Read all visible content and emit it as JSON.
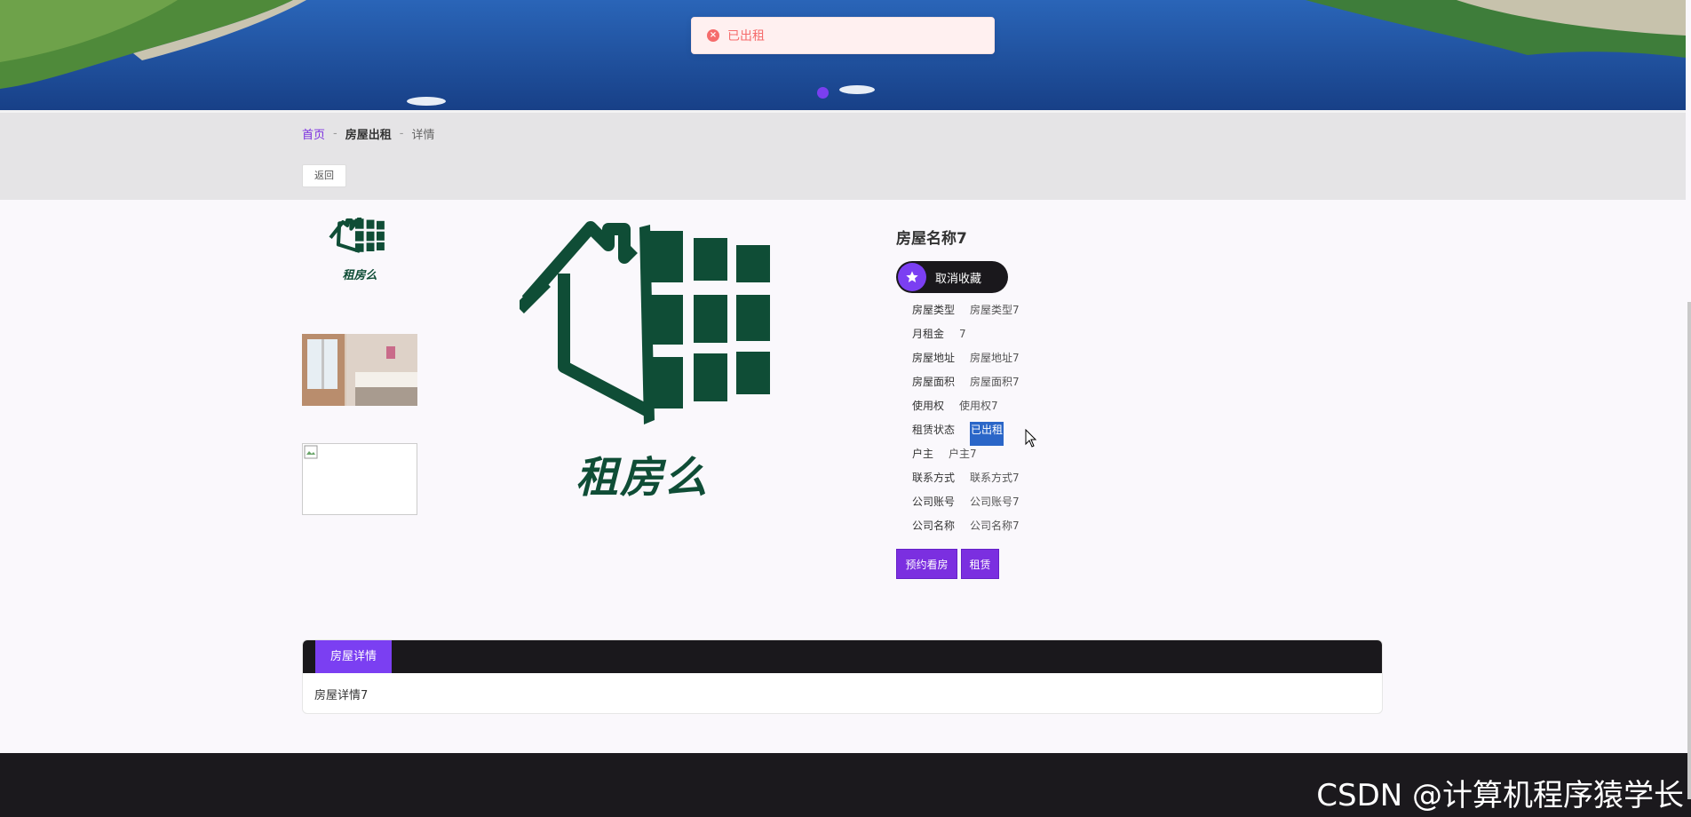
{
  "toast": {
    "message": "已出租",
    "icon": "error-icon"
  },
  "breadcrumb": {
    "home": "首页",
    "sep1": "-",
    "section": "房屋出租",
    "sep2": "-",
    "current": "详情"
  },
  "back_button": "返回",
  "logo_text": "租房么",
  "house": {
    "title": "房屋名称7",
    "favorite_label": "取消收藏",
    "fields": [
      {
        "key": "房屋类型",
        "value": "房屋类型7"
      },
      {
        "key": "月租金",
        "value": "7"
      },
      {
        "key": "房屋地址",
        "value": "房屋地址7"
      },
      {
        "key": "房屋面积",
        "value": "房屋面积7"
      },
      {
        "key": "使用权",
        "value": "使用权7"
      },
      {
        "key": "租赁状态",
        "value": "已出租"
      },
      {
        "key": "户主",
        "value": "户主7"
      },
      {
        "key": "联系方式",
        "value": "联系方式7"
      },
      {
        "key": "公司账号",
        "value": "公司账号7"
      },
      {
        "key": "公司名称",
        "value": "公司名称7"
      }
    ],
    "actions": {
      "appointment": "预约看房",
      "rent": "租赁"
    }
  },
  "details": {
    "tab": "房屋详情",
    "content": "房屋详情7"
  },
  "watermark": "CSDN @计算机程序猿学长",
  "colors": {
    "accent": "#7b2fe0",
    "logo_green": "#0f4d36",
    "dark": "#1a181c"
  }
}
